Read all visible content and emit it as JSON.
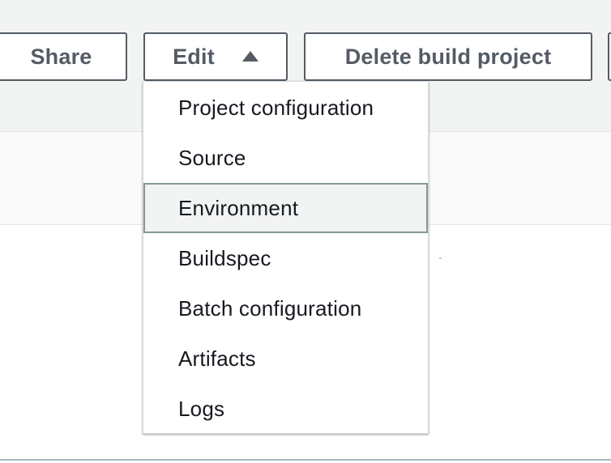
{
  "toolbar": {
    "share_label": "Share",
    "edit_label": "Edit",
    "delete_label": "Delete build project"
  },
  "edit_menu": {
    "expanded": true,
    "highlighted_item": "Environment",
    "items": [
      {
        "label": "Project configuration"
      },
      {
        "label": "Source"
      },
      {
        "label": "Environment"
      },
      {
        "label": "Buildspec"
      },
      {
        "label": "Batch configuration"
      },
      {
        "label": "Artifacts"
      },
      {
        "label": "Logs"
      }
    ]
  },
  "icons": {
    "edit_caret": "caret-up-icon"
  },
  "colors": {
    "button_border": "#545b64",
    "button_text": "#545b64",
    "page_background_top": "#f2f3f3",
    "menu_highlight_border": "#879596",
    "menu_highlight_bg": "#f2f3f3"
  }
}
